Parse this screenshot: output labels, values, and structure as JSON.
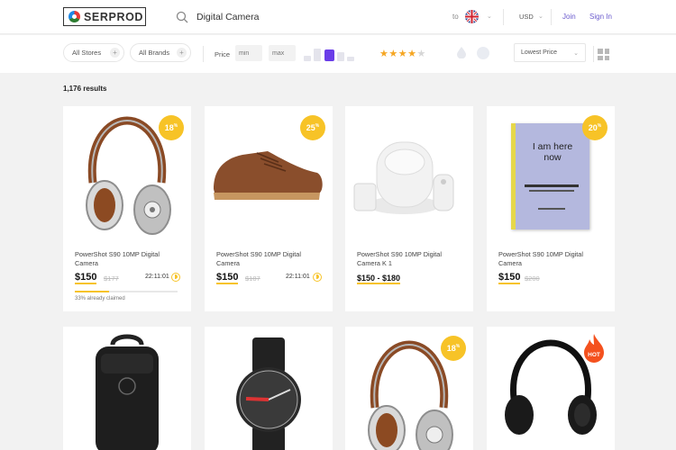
{
  "header": {
    "logo_text": "SERPROD",
    "search_value": "Digital Camera",
    "ship_to": "to",
    "currency": "USD",
    "join": "Join",
    "sign_in": "Sign In"
  },
  "filters": {
    "stores": "All Stores",
    "brands": "All Brands",
    "price_label": "Price",
    "min_placeholder": "min",
    "max_placeholder": "max",
    "rating": 4,
    "rating_max": 5,
    "sort": "Lowest Price"
  },
  "results_count": "1,176 results",
  "colors": {
    "accent": "#f7c327",
    "link": "#6a5acd",
    "histogram_active": "#6a3de8"
  },
  "products": [
    {
      "title": "PowerShot S90 10MP Digital Camera",
      "price": "$150",
      "old_price": "$177",
      "timer": "22:11:01",
      "discount": "18",
      "claimed": "33% already claimed",
      "claimed_fraction": 0.33,
      "image": "headphones-brown"
    },
    {
      "title": "PowerShot S90 10MP Digital Camera",
      "price": "$150",
      "old_price": "$187",
      "timer": "22:11:01",
      "discount": "25",
      "image": "shoe-brown"
    },
    {
      "title": "PowerShot S90 10MP Digital Camera K 1",
      "price": "$150 - $180",
      "image": "smart-home-kit"
    },
    {
      "title": "PowerShot S90 10MP Digital Camera",
      "price": "$150",
      "old_price": "$200",
      "discount": "20",
      "image": "book-i-am-here-now",
      "book_title": "I am here now"
    },
    {
      "image": "backpack-black"
    },
    {
      "image": "watch-black"
    },
    {
      "discount": "18",
      "image": "headphones-brown"
    },
    {
      "badge": "HOT",
      "image": "headphones-black"
    }
  ]
}
